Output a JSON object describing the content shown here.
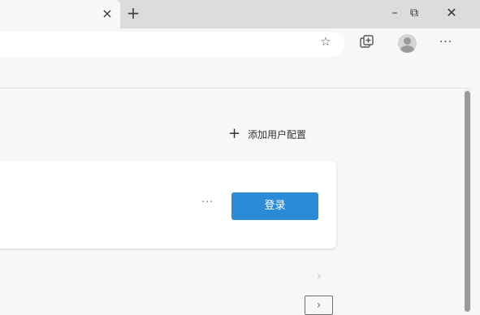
{
  "tabbar": {
    "close_glyph": "×",
    "new_tab_glyph": "+"
  },
  "window": {
    "minimize_glyph": "–",
    "restore_glyph": "⧉",
    "close_glyph": "✕"
  },
  "toolbar": {
    "favorite_glyph": "☆",
    "more_glyph": "···"
  },
  "profile": {
    "add_label": "添加用户配置",
    "add_glyph": "+",
    "card_more_glyph": "···",
    "signin_label": "登录"
  },
  "pager": {
    "chevron_small": "›",
    "chevron_box": "›"
  },
  "colors": {
    "accent": "#2b8bd9",
    "page_bg": "#f7f7f7",
    "tabbar_bg": "#dcdcdc"
  }
}
